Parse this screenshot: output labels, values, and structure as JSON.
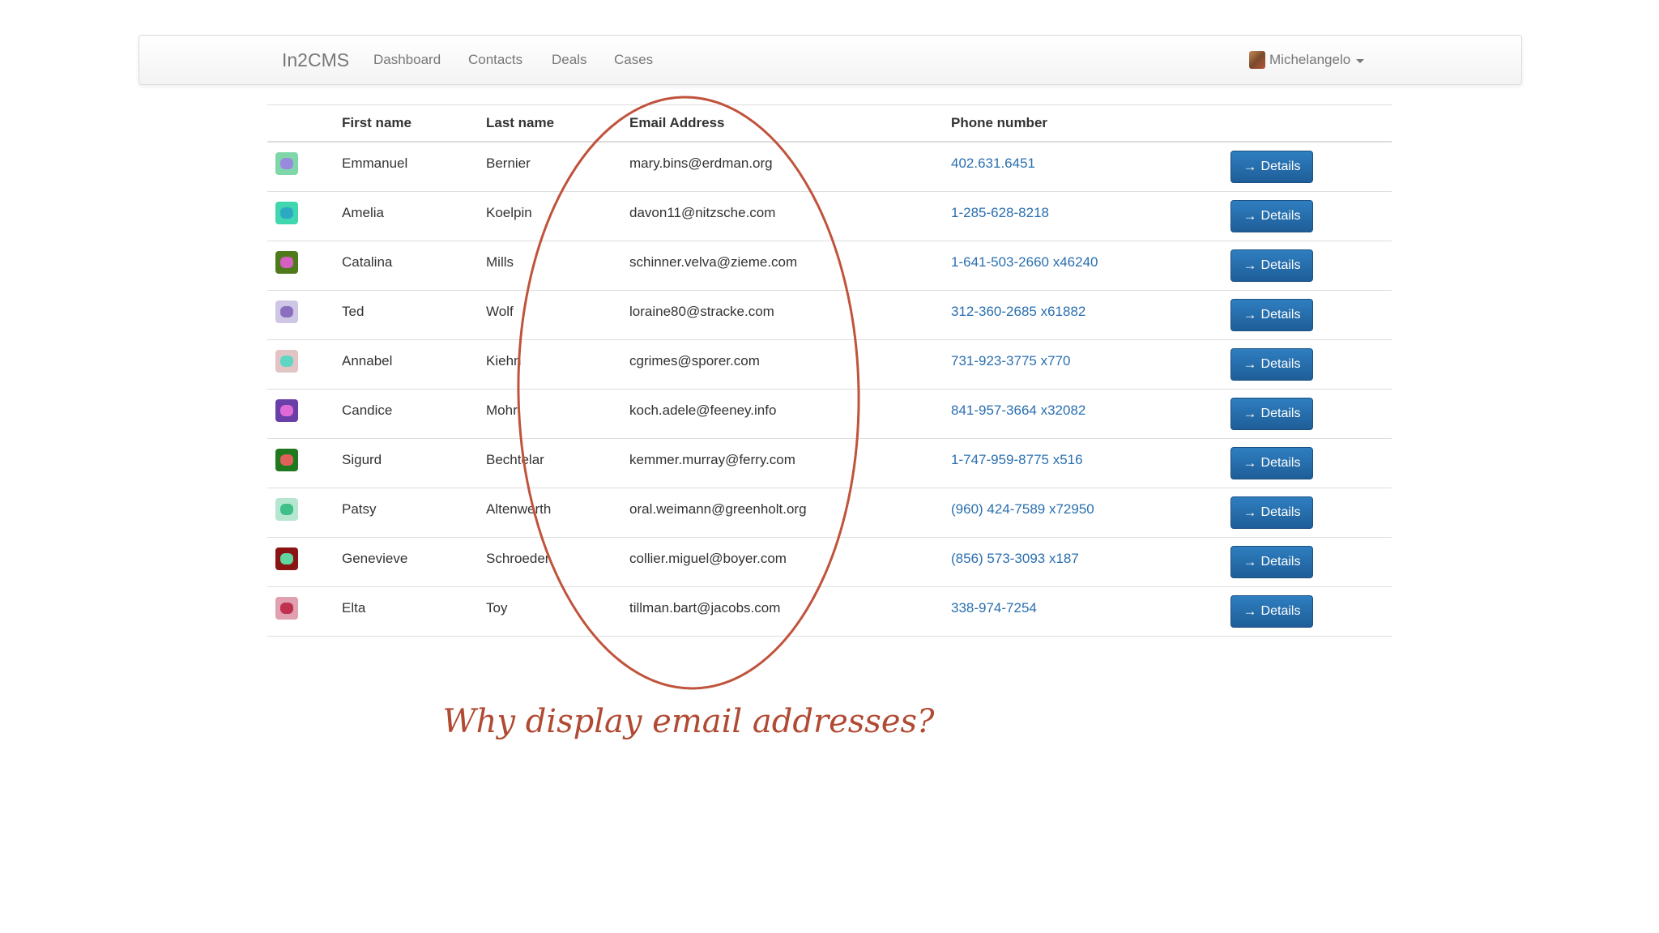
{
  "navbar": {
    "brand": "In2CMS",
    "items": [
      "Dashboard",
      "Contacts",
      "Deals",
      "Cases"
    ],
    "user_name": "Michelangelo"
  },
  "table": {
    "headers": [
      "First name",
      "Last name",
      "Email Address",
      "Phone number"
    ],
    "button_label": "Details",
    "rows": [
      {
        "first": "Emmanuel",
        "last": "Bernier",
        "email": "mary.bins@erdman.org",
        "phone": "402.631.6451",
        "avatar_color": "#7fd6a8",
        "face_color": "#9a8adf"
      },
      {
        "first": "Amelia",
        "last": "Koelpin",
        "email": "davon11@nitzsche.com",
        "phone": "1-285-628-8218",
        "avatar_color": "#3fd6b0",
        "face_color": "#2ea9c4"
      },
      {
        "first": "Catalina",
        "last": "Mills",
        "email": "schinner.velva@zieme.com",
        "phone": "1-641-503-2660 x46240",
        "avatar_color": "#4f7a1c",
        "face_color": "#d65fc4"
      },
      {
        "first": "Ted",
        "last": "Wolf",
        "email": "loraine80@stracke.com",
        "phone": "312-360-2685 x61882",
        "avatar_color": "#cfc6e6",
        "face_color": "#8a6fbf"
      },
      {
        "first": "Annabel",
        "last": "Kiehn",
        "email": "cgrimes@sporer.com",
        "phone": "731-923-3775 x770",
        "avatar_color": "#e3c4c4",
        "face_color": "#5fd6c4"
      },
      {
        "first": "Candice",
        "last": "Mohr",
        "email": "koch.adele@feeney.info",
        "phone": "841-957-3664 x32082",
        "avatar_color": "#6a3fa8",
        "face_color": "#e06ad6"
      },
      {
        "first": "Sigurd",
        "last": "Bechtelar",
        "email": "kemmer.murray@ferry.com",
        "phone": "1-747-959-8775 x516",
        "avatar_color": "#1f7a1f",
        "face_color": "#e0605a"
      },
      {
        "first": "Patsy",
        "last": "Altenwerth",
        "email": "oral.weimann@greenholt.org",
        "phone": "(960) 424-7589 x72950",
        "avatar_color": "#b5e6cf",
        "face_color": "#3fbf8a"
      },
      {
        "first": "Genevieve",
        "last": "Schroeder",
        "email": "collier.miguel@boyer.com",
        "phone": "(856) 573-3093 x187",
        "avatar_color": "#8a1414",
        "face_color": "#5fd6a0"
      },
      {
        "first": "Elta",
        "last": "Toy",
        "email": "tillman.bart@jacobs.com",
        "phone": "338-974-7254",
        "avatar_color": "#e0a0b0",
        "face_color": "#c03050"
      }
    ]
  },
  "annotation": {
    "caption": "Why display email addresses?",
    "ring_color": "#c0533c"
  }
}
